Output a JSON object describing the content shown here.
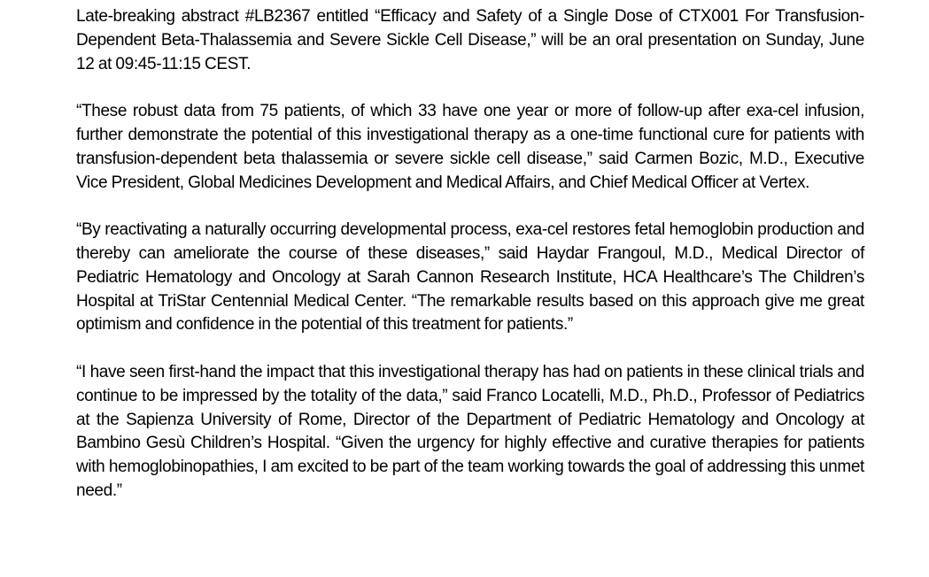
{
  "document": {
    "paragraphs": [
      "Late-breaking abstract #LB2367 entitled “Efficacy and Safety of a Single Dose of CTX001 For Transfusion-Dependent Beta-Thalassemia and Severe Sickle Cell Disease,” will be an oral presentation on Sunday, June 12 at 09:45-11:15 CEST.",
      "“These robust data from 75 patients, of which 33 have one year or more of follow-up after exa-cel infusion, further demonstrate the potential of this investigational therapy as a one-time functional cure for patients with transfusion-dependent beta thalassemia or severe sickle cell disease,” said Carmen Bozic, M.D., Executive Vice President, Global Medicines Development and Medical Affairs, and Chief Medical Officer at Vertex.",
      "“By reactivating a naturally occurring developmental process, exa-cel restores fetal hemoglobin production and thereby can ameliorate the course of these diseases,” said Haydar Frangoul, M.D., Medical Director of Pediatric Hematology and Oncology at Sarah Cannon Research Institute, HCA Healthcare’s The Children’s Hospital at TriStar Centennial Medical Center. “The remarkable results based on this approach give me great optimism and confidence in the potential of this treatment for patients.”",
      "“I have seen first-hand the impact that this investigational therapy has had on patients in these clinical trials and continue to be impressed by the totality of the data,” said Franco Locatelli, M.D., Ph.D., Professor of Pediatrics at the Sapienza University of Rome, Director of the Department of Pediatric Hematology and Oncology at Bambino Gesù Children’s Hospital. “Given the urgency for highly effective and curative therapies for patients with hemoglobinopathies, I am excited to be part of the team working towards the goal of addressing this unmet need.”"
    ]
  }
}
